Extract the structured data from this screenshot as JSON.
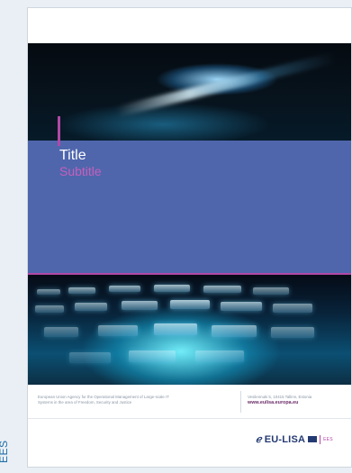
{
  "side_label": "EES",
  "cover": {
    "title": "Title",
    "subtitle": "Subtitle",
    "footer": {
      "agency_text": "European Union Agency for the Operational Management of Large-scale IT Systems in the area of Freedom, Security and Justice",
      "address": "Vesilennuki 5, 10415 Tallinn, Estonia",
      "website": "www.eulisa.europa.eu"
    },
    "logo": {
      "name": "EU-LISA",
      "suffix": "EES"
    }
  },
  "colors": {
    "title_band": "#4f66ad",
    "accent": "#b248a7",
    "brand": "#243a72",
    "side_label": "#1f6ea8"
  },
  "icons": [
    "eu-lisa-logo-mark",
    "eu-flag-icon"
  ]
}
